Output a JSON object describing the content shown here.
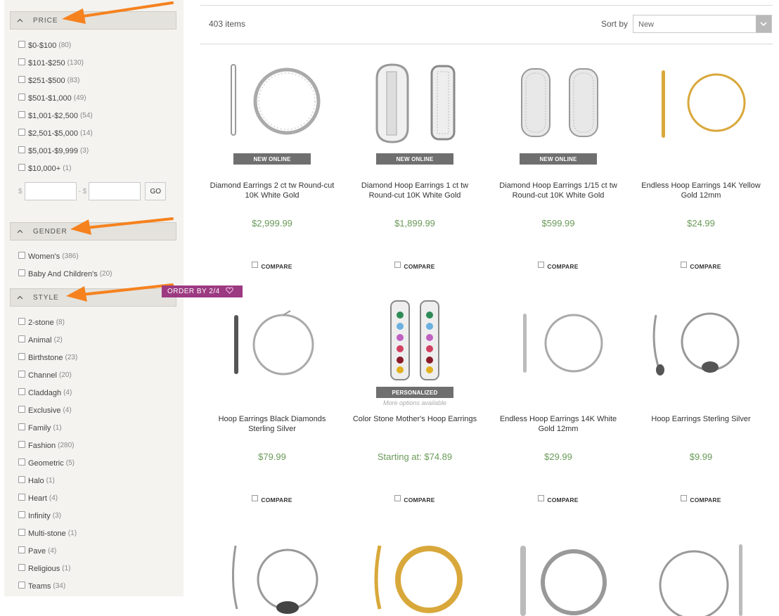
{
  "sidebar": {
    "price": {
      "title": "PRICE",
      "items": [
        {
          "label": "$0-$100",
          "count": "(80)"
        },
        {
          "label": "$101-$250",
          "count": "(130)"
        },
        {
          "label": "$251-$500",
          "count": "(83)"
        },
        {
          "label": "$501-$1,000",
          "count": "(49)"
        },
        {
          "label": "$1,001-$2,500",
          "count": "(54)"
        },
        {
          "label": "$2,501-$5,000",
          "count": "(14)"
        },
        {
          "label": "$5,001-$9,999",
          "count": "(3)"
        },
        {
          "label": "$10,000+",
          "count": "(1)"
        }
      ],
      "min_symbol": "$",
      "max_symbol": "- $",
      "min_value": "",
      "max_value": "",
      "go_label": "GO"
    },
    "gender": {
      "title": "GENDER",
      "items": [
        {
          "label": "Women's",
          "count": "(386)"
        },
        {
          "label": "Baby And Children's",
          "count": "(20)"
        }
      ]
    },
    "style": {
      "title": "STYLE",
      "items": [
        {
          "label": "2-stone",
          "count": "(8)"
        },
        {
          "label": "Animal",
          "count": "(2)"
        },
        {
          "label": "Birthstone",
          "count": "(23)"
        },
        {
          "label": "Channel",
          "count": "(20)"
        },
        {
          "label": "Claddagh",
          "count": "(4)"
        },
        {
          "label": "Exclusive",
          "count": "(4)"
        },
        {
          "label": "Family",
          "count": "(1)"
        },
        {
          "label": "Fashion",
          "count": "(280)"
        },
        {
          "label": "Geometric",
          "count": "(5)"
        },
        {
          "label": "Halo",
          "count": "(1)"
        },
        {
          "label": "Heart",
          "count": "(4)"
        },
        {
          "label": "Infinity",
          "count": "(3)"
        },
        {
          "label": "Multi-stone",
          "count": "(1)"
        },
        {
          "label": "Pave",
          "count": "(4)"
        },
        {
          "label": "Religious",
          "count": "(1)"
        },
        {
          "label": "Teams",
          "count": "(34)"
        }
      ]
    }
  },
  "toolbar": {
    "item_count": "403 items",
    "sort_label": "Sort by",
    "sort_value": "New"
  },
  "colors": {
    "price": "#6a9a59",
    "badge": "#6f6f6f",
    "ribbon": "#9c3a82",
    "arrow": "#f5821f"
  },
  "products": [
    {
      "badge": "NEW ONLINE",
      "name": "Diamond Earrings 2 ct tw Round-cut 10K White Gold",
      "price": "$2,999.99",
      "compare": "COMPARE"
    },
    {
      "badge": "NEW ONLINE",
      "name": "Diamond Hoop Earrings 1 ct tw Round-cut 10K White Gold",
      "price": "$1,899.99",
      "compare": "COMPARE"
    },
    {
      "badge": "NEW ONLINE",
      "name": "Diamond Hoop Earrings 1/15 ct tw Round-cut 10K White Gold",
      "price": "$599.99",
      "compare": "COMPARE"
    },
    {
      "badge": "",
      "name": "Endless Hoop Earrings 14K Yellow Gold 12mm",
      "price": "$24.99",
      "compare": "COMPARE"
    },
    {
      "badge": "",
      "name": "Hoop Earrings Black Diamonds Sterling Silver",
      "price": "$79.99",
      "compare": "COMPARE"
    },
    {
      "badge": "PERSONALIZED",
      "ribbon": "ORDER BY 2/4",
      "more": "More options available",
      "name": "Color Stone Mother's Hoop Earrings",
      "price": "Starting at:  $74.89",
      "compare": "COMPARE"
    },
    {
      "badge": "",
      "name": "Endless Hoop Earrings 14K White Gold 12mm",
      "price": "$29.99",
      "compare": "COMPARE"
    },
    {
      "badge": "",
      "name": "Hoop Earrings Sterling Silver",
      "price": "$9.99",
      "compare": "COMPARE"
    }
  ]
}
